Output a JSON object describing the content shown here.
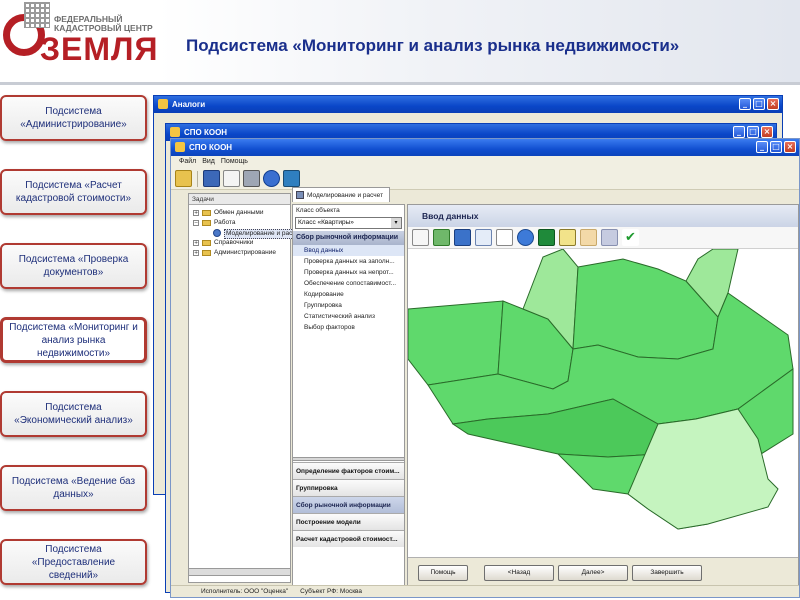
{
  "logo": {
    "org_text": "ФЕДЕРАЛЬНЫЙ КАДАСТРОВЫЙ ЦЕНТР",
    "brand": "ЗЕМЛЯ"
  },
  "page_title": "Подсистема «Мониторинг и анализ рынка недвижимости»",
  "colors": {
    "accent_red": "#b51f25",
    "title_blue": "#1a2f8c",
    "map_green_dark": "#5ed86a",
    "map_green_light": "#bff3b8"
  },
  "left_menu": [
    {
      "label": "Подсистема «Администрирование»",
      "active": false
    },
    {
      "label": "Подсистема «Расчет кадастровой стоимости»",
      "active": false
    },
    {
      "label": "Подсистема «Проверка документов»",
      "active": false
    },
    {
      "label": "Подсистема «Мониторинг и анализ рынка недвижимости»",
      "active": true
    },
    {
      "label": "Подсистема «Экономический анализ»",
      "active": false
    },
    {
      "label": "Подсистема «Ведение баз данных»",
      "active": false
    },
    {
      "label": "Подсистема «Предоставление сведений»",
      "active": false
    }
  ],
  "windows": {
    "analogs_title": "Аналоги",
    "spo_title_back": "СПО КООН",
    "spo_title_front": "СПО КООН",
    "menu": [
      "Файл",
      "Вид",
      "Помощь"
    ]
  },
  "tasks_panel": {
    "header": "Задачи",
    "tree": [
      {
        "label": "Обмен данными",
        "expander": "+",
        "level": 1,
        "selected": false
      },
      {
        "label": "Работа",
        "expander": "−",
        "level": 1,
        "selected": false
      },
      {
        "label": "Моделирование и расч",
        "expander": "",
        "level": 2,
        "selected": true
      },
      {
        "label": "Справочники",
        "expander": "+",
        "level": 1,
        "selected": false
      },
      {
        "label": "Администрирование",
        "expander": "+",
        "level": 1,
        "selected": false
      }
    ]
  },
  "document_tab": "Моделирование и расчет",
  "class_panel": {
    "label": "Класс объекта",
    "selected_class": "Класс «Квартиры»",
    "section_header": "Сбор рыночной информации",
    "steps": [
      {
        "label": "Ввод данных",
        "selected": true
      },
      {
        "label": "Проверка данных на заполн...",
        "selected": false
      },
      {
        "label": "Проверка данных на непрот...",
        "selected": false
      },
      {
        "label": "Обеспечение сопоставимост...",
        "selected": false
      },
      {
        "label": "Кодирование",
        "selected": false
      },
      {
        "label": "Группировка",
        "selected": false
      },
      {
        "label": "Статистический анализ",
        "selected": false
      },
      {
        "label": "Выбор факторов",
        "selected": false
      }
    ],
    "groups": [
      {
        "label": "Определение факторов стоим...",
        "selected": false
      },
      {
        "label": "Группировка",
        "selected": false
      },
      {
        "label": "Сбор рыночной информации",
        "selected": true
      },
      {
        "label": "Построение модели",
        "selected": false
      },
      {
        "label": "Расчет кадастровой стоимост...",
        "selected": false
      }
    ]
  },
  "content": {
    "title": "Ввод данных",
    "toolbar_icons": [
      "page-menu-icon",
      "check-menu-icon",
      "select-icon",
      "edit-icon",
      "blank-page-icon",
      "refresh-icon",
      "excel-icon",
      "notes-icon",
      "export-icon",
      "save-icon",
      "apply-check-icon"
    ],
    "wizard_buttons": [
      "Помощь",
      "<Назад",
      "Далее>",
      "Завершить"
    ]
  },
  "back_fragments": [
    "Оп",
    "Гр",
    "Сб",
    "По",
    "Ра"
  ],
  "statusbar": {
    "executor": "Исполнитель: ООО \"Оценка\"",
    "subject": "Субъект РФ: Москва"
  }
}
